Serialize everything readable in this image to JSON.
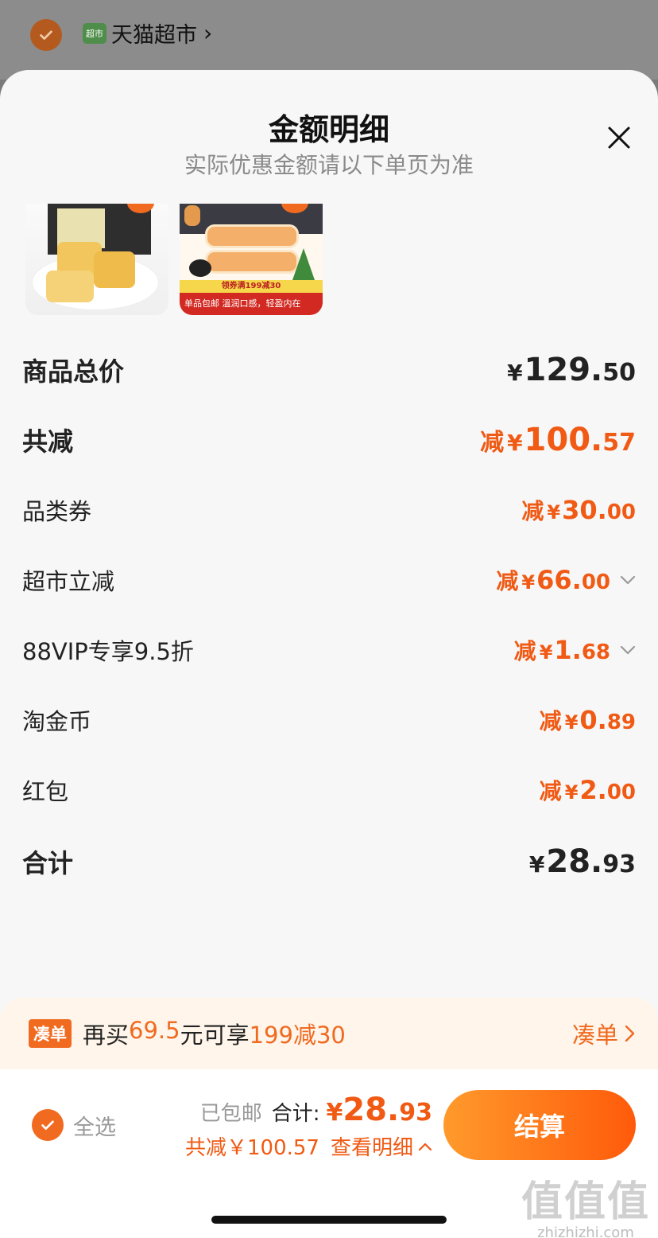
{
  "store": {
    "logo_text": "超市",
    "name": "天猫超市"
  },
  "sheet": {
    "title": "金额明细",
    "subtitle": "实际优惠金额请以下单页为准"
  },
  "products": [
    {
      "alt": "cake-product"
    },
    {
      "band_top": "领券满199减30",
      "band_bottom": "溫润口感，轻盈内在",
      "ribbon": "单品包邮"
    }
  ],
  "rows": {
    "goods_total": {
      "label": "商品总价",
      "prefix": "",
      "yen": "¥",
      "int": "129.",
      "dec": "50"
    },
    "total_discount": {
      "label": "共减",
      "prefix": "减",
      "yen": "¥",
      "int": "100.",
      "dec": "57"
    },
    "category_coupon": {
      "label": "品类券",
      "prefix": "减",
      "yen": "¥",
      "int": "30.",
      "dec": "00"
    },
    "market_discount": {
      "label": "超市立减",
      "prefix": "减",
      "yen": "¥",
      "int": "66.",
      "dec": "00"
    },
    "vip_discount": {
      "label": "88VIP专享9.5折",
      "prefix": "减",
      "yen": "¥",
      "int": "1.",
      "dec": "68"
    },
    "taojin_coin": {
      "label": "淘金币",
      "prefix": "减",
      "yen": "¥",
      "int": "0.",
      "dec": "89"
    },
    "red_packet": {
      "label": "红包",
      "prefix": "减",
      "yen": "¥",
      "int": "2.",
      "dec": "00"
    },
    "total": {
      "label": "合计",
      "yen": "¥",
      "int": "28.",
      "dec": "93"
    }
  },
  "promo": {
    "badge": "凑单",
    "text_a": "再买",
    "amount": "69.5",
    "text_b": "元可享",
    "offer": "199减30",
    "link": "凑单"
  },
  "bottom": {
    "select_all": "全选",
    "shipping": "已包邮",
    "total_label": "合计:",
    "yen": "¥",
    "int": "28.",
    "dec": "93",
    "discount_text": "共减￥100.57",
    "detail_link": "查看明细",
    "checkout": "结算"
  },
  "watermark": {
    "big": "值值值",
    "small": "zhizhizhi.com"
  },
  "colors": {
    "accent": "#f05a14",
    "promo_bg": "#fff5ea",
    "sheet_bg": "#f7f7f7"
  }
}
